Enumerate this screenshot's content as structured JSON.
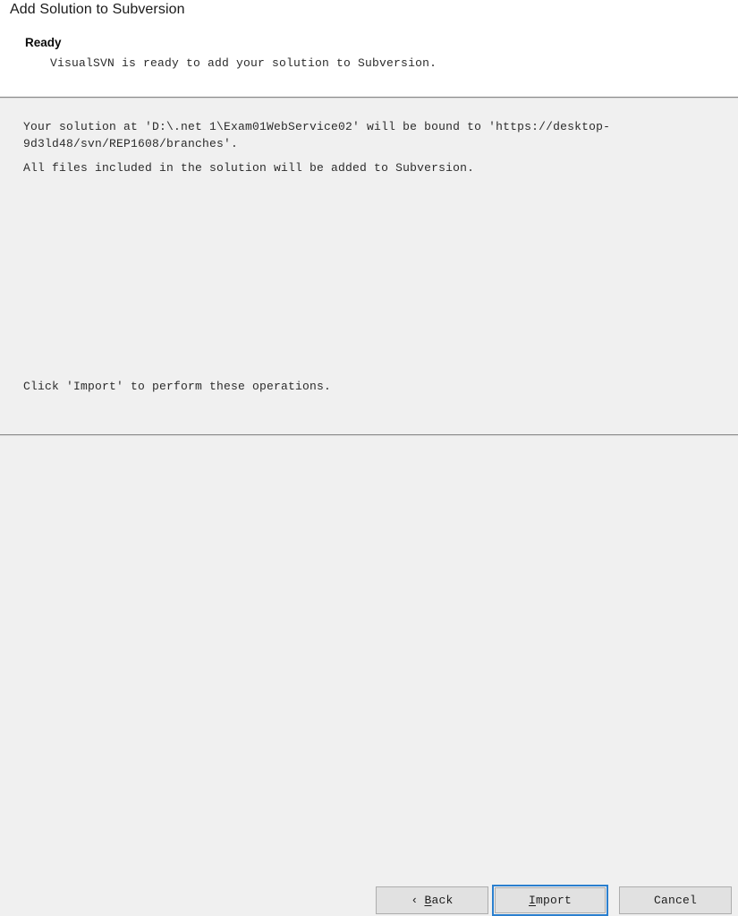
{
  "window": {
    "title": "Add Solution to Subversion"
  },
  "header": {
    "status_heading": "Ready",
    "status_text": "VisualSVN is ready to add your solution to Subversion."
  },
  "body": {
    "paragraph_1": "Your solution at 'D:\\.net 1\\Exam01WebService02' will be bound to 'https://desktop-9d3ld48/svn/REP1608/branches'.",
    "paragraph_2": "All files included in the solution will be added to Subversion.",
    "paragraph_3": "Click 'Import' to perform these operations."
  },
  "footer": {
    "back_chevron": "‹",
    "back_accel": "B",
    "back_rest": "ack",
    "import_accel": "I",
    "import_rest": "mport",
    "cancel_label": "Cancel"
  },
  "colors": {
    "focus_ring": "#2b7fce",
    "button_face": "#e1e1e1",
    "content_bg": "#f0f0f0",
    "header_bg": "#ffffff"
  }
}
